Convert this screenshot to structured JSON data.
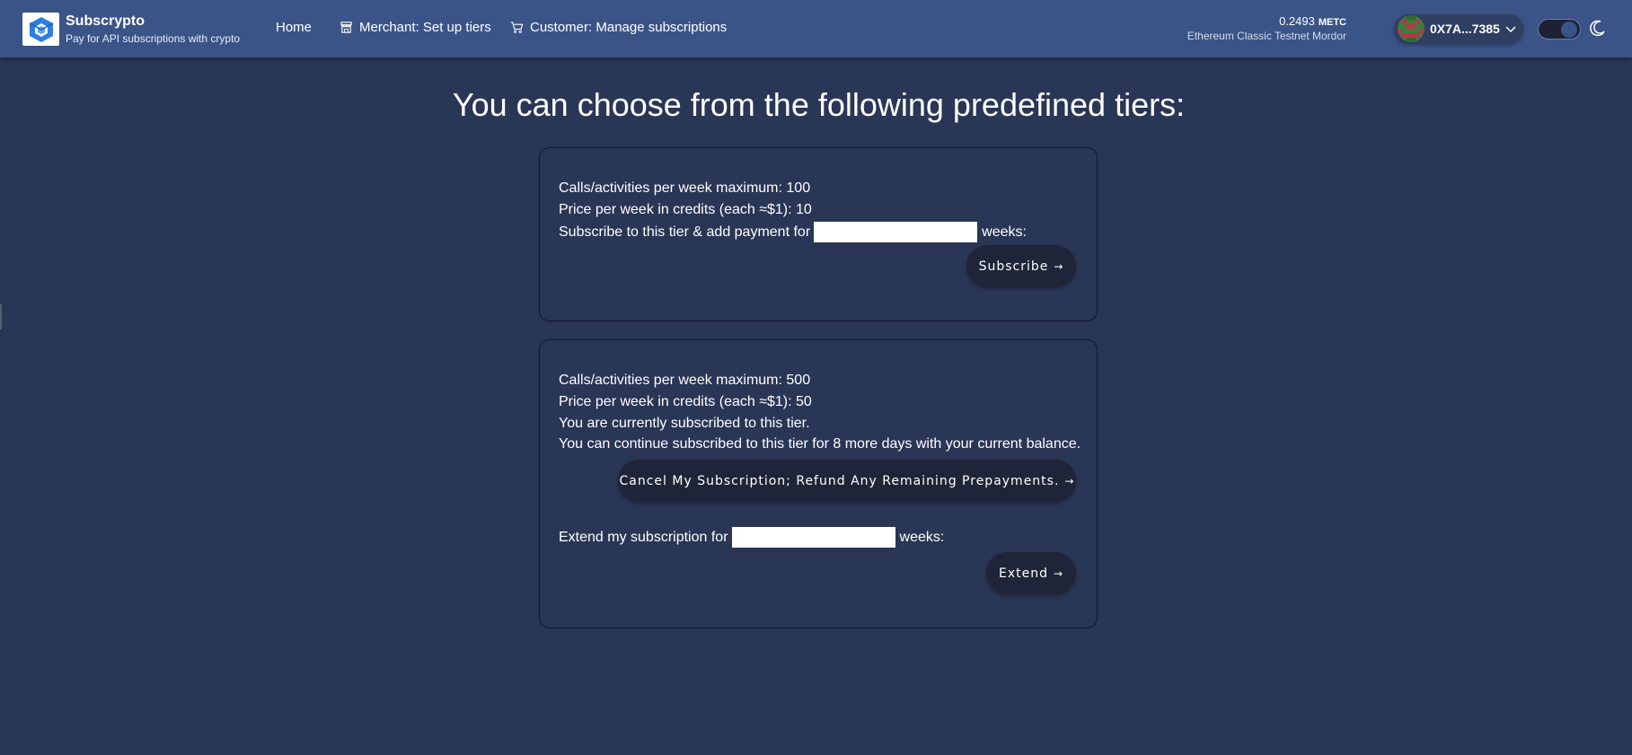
{
  "header": {
    "brand": {
      "title": "Subscrypto",
      "subtitle": "Pay for API subscriptions with crypto",
      "logo_icon": "cube-logo-icon"
    },
    "nav": [
      {
        "label": "Home",
        "icon": ""
      },
      {
        "label": "Merchant: Set up tiers",
        "icon": "store-icon"
      },
      {
        "label": "Customer: Manage subscriptions",
        "icon": "cart-icon"
      }
    ],
    "balance": {
      "amount": "0.2493",
      "unit": "METC",
      "network": "Ethereum Classic Testnet Mordor"
    },
    "account": {
      "address": "0X7A...7385",
      "avatar_icon": "identicon-avatar"
    },
    "theme": {
      "mode": "dark",
      "icon": "moon-icon"
    }
  },
  "main": {
    "title": "You can choose from the following predefined tiers:",
    "tiers": [
      {
        "calls": "Calls/activities per week maximum: 100",
        "price": "Price per week in credits (each ≈$1): 10",
        "subscribe_prefix": "Subscribe to this tier & add payment for",
        "subscribe_suffix": "weeks:",
        "weeks_value": "",
        "button": "Subscribe"
      },
      {
        "calls": "Calls/activities per week maximum: 500",
        "price": "Price per week in credits (each ≈$1): 50",
        "status": "You are currently subscribed to this tier.",
        "remaining": "You can continue subscribed to this tier for 8 more days with your current balance.",
        "cancel_button": "Cancel My Subscription; Refund Any Remaining Prepayments.",
        "extend_prefix": "Extend my subscription for",
        "extend_suffix": "weeks:",
        "weeks_value": "",
        "extend_button": "Extend"
      }
    ]
  },
  "colors": {
    "header_bg": "#3a5487",
    "page_bg": "#2a3655",
    "button_bg": "#1f2438"
  }
}
